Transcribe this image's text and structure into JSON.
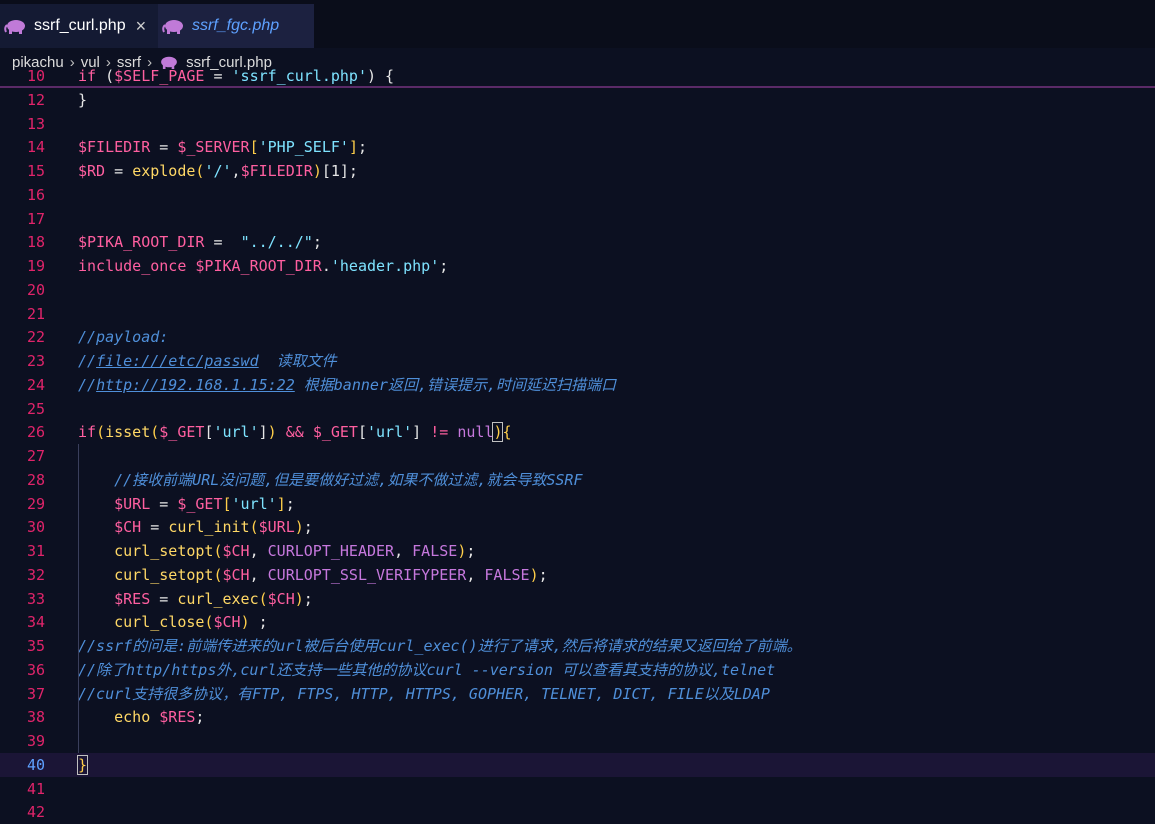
{
  "tabs": [
    {
      "label": "ssrf_curl.php",
      "active": true,
      "icon": "php-elephant-icon"
    },
    {
      "label": "ssrf_fgc.php",
      "active": false,
      "icon": "php-elephant-icon"
    }
  ],
  "tab_close_glyph": "×",
  "breadcrumb": [
    "pikachu",
    "vul",
    "ssrf",
    "ssrf_curl.php"
  ],
  "current_line": 40,
  "colors": {
    "background": "#0c1021",
    "line_number": "#e0246a",
    "current_line_number": "#5ea1ff",
    "comment": "#4f8fd9"
  },
  "lines": [
    {
      "n": 10,
      "tokens": [
        [
          "kw",
          "if"
        ],
        [
          "pl",
          " ("
        ],
        [
          "var",
          "$SELF_PAGE"
        ],
        [
          "pl",
          " = "
        ],
        [
          "str",
          "'ssrf_curl.php'"
        ],
        [
          "pl",
          ") {"
        ]
      ]
    },
    {
      "n": 12,
      "tokens": [
        [
          "pl",
          "}"
        ]
      ]
    },
    {
      "n": 13,
      "tokens": []
    },
    {
      "n": 14,
      "tokens": [
        [
          "var",
          "$FILEDIR"
        ],
        [
          "pl",
          " = "
        ],
        [
          "var",
          "$_SERVER"
        ],
        [
          "br",
          "["
        ],
        [
          "str",
          "'PHP_SELF'"
        ],
        [
          "br",
          "]"
        ],
        [
          "pl",
          ";"
        ]
      ]
    },
    {
      "n": 15,
      "tokens": [
        [
          "var",
          "$RD"
        ],
        [
          "pl",
          " = "
        ],
        [
          "fn",
          "explode"
        ],
        [
          "br",
          "("
        ],
        [
          "str",
          "'/'"
        ],
        [
          "pl",
          ","
        ],
        [
          "var",
          "$FILEDIR"
        ],
        [
          "br",
          ")"
        ],
        [
          "pl",
          "["
        ],
        [
          "pl",
          "1"
        ],
        [
          "pl",
          "];"
        ]
      ]
    },
    {
      "n": 16,
      "tokens": []
    },
    {
      "n": 17,
      "tokens": []
    },
    {
      "n": 18,
      "tokens": [
        [
          "var",
          "$PIKA_ROOT_DIR"
        ],
        [
          "pl",
          " =  "
        ],
        [
          "str",
          "\"../../\""
        ],
        [
          "pl",
          ";"
        ]
      ]
    },
    {
      "n": 19,
      "tokens": [
        [
          "kw",
          "include_once"
        ],
        [
          "pl",
          " "
        ],
        [
          "var",
          "$PIKA_ROOT_DIR"
        ],
        [
          "pl",
          "."
        ],
        [
          "str",
          "'header.php'"
        ],
        [
          "pl",
          ";"
        ]
      ]
    },
    {
      "n": 20,
      "tokens": []
    },
    {
      "n": 21,
      "tokens": []
    },
    {
      "n": 22,
      "tokens": [
        [
          "cm",
          "//payload:"
        ]
      ]
    },
    {
      "n": 23,
      "tokens": [
        [
          "cm",
          "//"
        ],
        [
          "cmu",
          "file:///etc/passwd"
        ],
        [
          "cm",
          "  读取文件"
        ]
      ]
    },
    {
      "n": 24,
      "tokens": [
        [
          "cm",
          "//"
        ],
        [
          "cmu",
          "http://192.168.1.15:22"
        ],
        [
          "cm",
          " 根据banner返回,错误提示,时间延迟扫描端口"
        ]
      ]
    },
    {
      "n": 25,
      "tokens": []
    },
    {
      "n": 26,
      "tokens": [
        [
          "kw",
          "if"
        ],
        [
          "br",
          "("
        ],
        [
          "fn",
          "isset"
        ],
        [
          "br",
          "("
        ],
        [
          "var",
          "$_GET"
        ],
        [
          "pl",
          "["
        ],
        [
          "str",
          "'url'"
        ],
        [
          "pl",
          "]"
        ],
        [
          "br",
          ")"
        ],
        [
          "pl",
          " "
        ],
        [
          "kw",
          "&&"
        ],
        [
          "pl",
          " "
        ],
        [
          "var",
          "$_GET"
        ],
        [
          "pl",
          "["
        ],
        [
          "str",
          "'url'"
        ],
        [
          "pl",
          "] "
        ],
        [
          "kw",
          "!="
        ],
        [
          "pl",
          " "
        ],
        [
          "const",
          "null"
        ],
        [
          "brbox",
          ")"
        ],
        [
          "br",
          "{"
        ]
      ]
    },
    {
      "n": 27,
      "tokens": []
    },
    {
      "n": 28,
      "tokens": [
        [
          "pl",
          "    "
        ],
        [
          "cm",
          "//接收前端URL没问题,但是要做好过滤,如果不做过滤,就会导致SSRF"
        ]
      ]
    },
    {
      "n": 29,
      "tokens": [
        [
          "pl",
          "    "
        ],
        [
          "var",
          "$URL"
        ],
        [
          "pl",
          " = "
        ],
        [
          "var",
          "$_GET"
        ],
        [
          "br",
          "["
        ],
        [
          "str",
          "'url'"
        ],
        [
          "br",
          "]"
        ],
        [
          "pl",
          ";"
        ]
      ]
    },
    {
      "n": 30,
      "tokens": [
        [
          "pl",
          "    "
        ],
        [
          "var",
          "$CH"
        ],
        [
          "pl",
          " = "
        ],
        [
          "fn",
          "curl_init"
        ],
        [
          "br",
          "("
        ],
        [
          "var",
          "$URL"
        ],
        [
          "br",
          ")"
        ],
        [
          "pl",
          ";"
        ]
      ]
    },
    {
      "n": 31,
      "tokens": [
        [
          "pl",
          "    "
        ],
        [
          "fn",
          "curl_setopt"
        ],
        [
          "br",
          "("
        ],
        [
          "var",
          "$CH"
        ],
        [
          "pl",
          ", "
        ],
        [
          "const",
          "CURLOPT_HEADER"
        ],
        [
          "pl",
          ", "
        ],
        [
          "const",
          "FALSE"
        ],
        [
          "br",
          ")"
        ],
        [
          "pl",
          ";"
        ]
      ]
    },
    {
      "n": 32,
      "tokens": [
        [
          "pl",
          "    "
        ],
        [
          "fn",
          "curl_setopt"
        ],
        [
          "br",
          "("
        ],
        [
          "var",
          "$CH"
        ],
        [
          "pl",
          ", "
        ],
        [
          "const",
          "CURLOPT_SSL_VERIFYPEER"
        ],
        [
          "pl",
          ", "
        ],
        [
          "const",
          "FALSE"
        ],
        [
          "br",
          ")"
        ],
        [
          "pl",
          ";"
        ]
      ]
    },
    {
      "n": 33,
      "tokens": [
        [
          "pl",
          "    "
        ],
        [
          "var",
          "$RES"
        ],
        [
          "pl",
          " = "
        ],
        [
          "fn",
          "curl_exec"
        ],
        [
          "br",
          "("
        ],
        [
          "var",
          "$CH"
        ],
        [
          "br",
          ")"
        ],
        [
          "pl",
          ";"
        ]
      ]
    },
    {
      "n": 34,
      "tokens": [
        [
          "pl",
          "    "
        ],
        [
          "fn",
          "curl_close"
        ],
        [
          "br",
          "("
        ],
        [
          "var",
          "$CH"
        ],
        [
          "br",
          ")"
        ],
        [
          "pl",
          " ;"
        ]
      ]
    },
    {
      "n": 35,
      "tokens": [
        [
          "cm",
          "//ssrf的问是:前端传进来的url被后台使用curl_exec()进行了请求,然后将请求的结果又返回给了前端。"
        ]
      ]
    },
    {
      "n": 36,
      "tokens": [
        [
          "cm",
          "//除了http/https外,curl还支持一些其他的协议curl --version 可以查看其支持的协议,telnet"
        ]
      ]
    },
    {
      "n": 37,
      "tokens": [
        [
          "cm",
          "//curl支持很多协议，有FTP, FTPS, HTTP, HTTPS, GOPHER, TELNET, DICT, FILE以及LDAP"
        ]
      ]
    },
    {
      "n": 38,
      "tokens": [
        [
          "pl",
          "    "
        ],
        [
          "fn",
          "echo"
        ],
        [
          "pl",
          " "
        ],
        [
          "var",
          "$RES"
        ],
        [
          "pl",
          ";"
        ]
      ]
    },
    {
      "n": 39,
      "tokens": []
    },
    {
      "n": 40,
      "tokens": [
        [
          "brbox",
          "}"
        ]
      ]
    },
    {
      "n": 41,
      "tokens": []
    },
    {
      "n": 42,
      "tokens": []
    }
  ]
}
